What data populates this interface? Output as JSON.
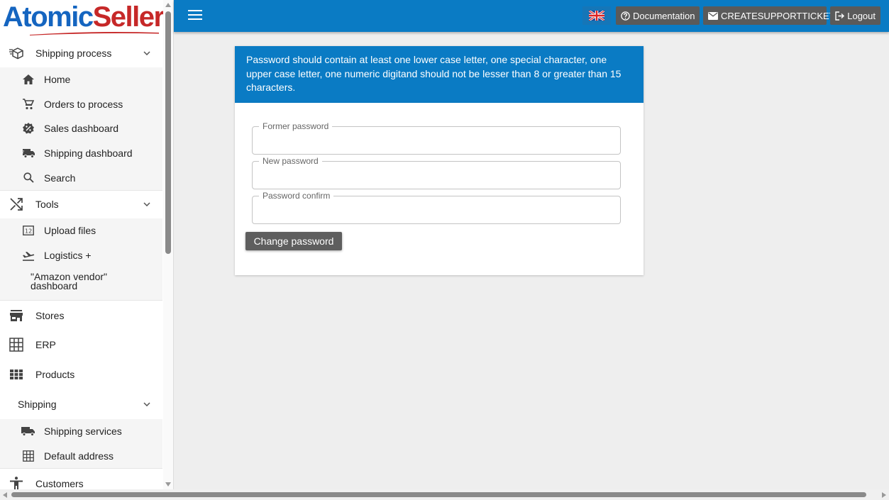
{
  "brand": {
    "part1": "Atomic",
    "part2": "Seller",
    "color_primary": "#1565c0",
    "color_accent": "#c62828"
  },
  "topbar": {
    "color": "#0a7bc4",
    "language_flag": "uk-flag-icon",
    "documentation_label": "Documentation",
    "support_label": "CREATESUPPORTTICKET",
    "logout_label": "Logout"
  },
  "sidebar": {
    "shipping_process": {
      "label": "Shipping process",
      "icon": "box-list-icon",
      "items": [
        {
          "label": "Home",
          "icon": "home-icon"
        },
        {
          "label": "Orders to process",
          "icon": "cart-icon"
        },
        {
          "label": "Sales dashboard",
          "icon": "badge-percent-icon"
        },
        {
          "label": "Shipping dashboard",
          "icon": "truck-fast-icon"
        },
        {
          "label": "Search",
          "icon": "search-icon"
        }
      ]
    },
    "tools": {
      "label": "Tools",
      "icon": "shuffle-icon",
      "items": [
        {
          "label": "Upload files",
          "icon": "number-box-icon"
        },
        {
          "label": "Logistics +",
          "icon": "flight-takeoff-icon"
        },
        {
          "label": "\"Amazon vendor\" dashboard",
          "icon": ""
        }
      ]
    },
    "stores": {
      "label": "Stores",
      "icon": "store-icon"
    },
    "erp": {
      "label": "ERP",
      "icon": "grid-icon"
    },
    "products": {
      "label": "Products",
      "icon": "apps-icon"
    },
    "shipping": {
      "label": "Shipping",
      "items": [
        {
          "label": "Shipping services",
          "icon": "truck-icon"
        },
        {
          "label": "Default address",
          "icon": "grid-icon"
        }
      ]
    },
    "customers": {
      "label": "Customers",
      "icon": "accessibility-icon"
    }
  },
  "main": {
    "alert_text": "Password should contain at least one lower case letter, one special character, one upper case letter, one numeric digitand should not be lesser than 8 or greater than 15 characters.",
    "fields": {
      "former_password": {
        "label": "Former password",
        "value": ""
      },
      "new_password": {
        "label": "New password",
        "value": ""
      },
      "password_confirm": {
        "label": "Password confirm",
        "value": ""
      }
    },
    "submit_label": "Change password"
  }
}
